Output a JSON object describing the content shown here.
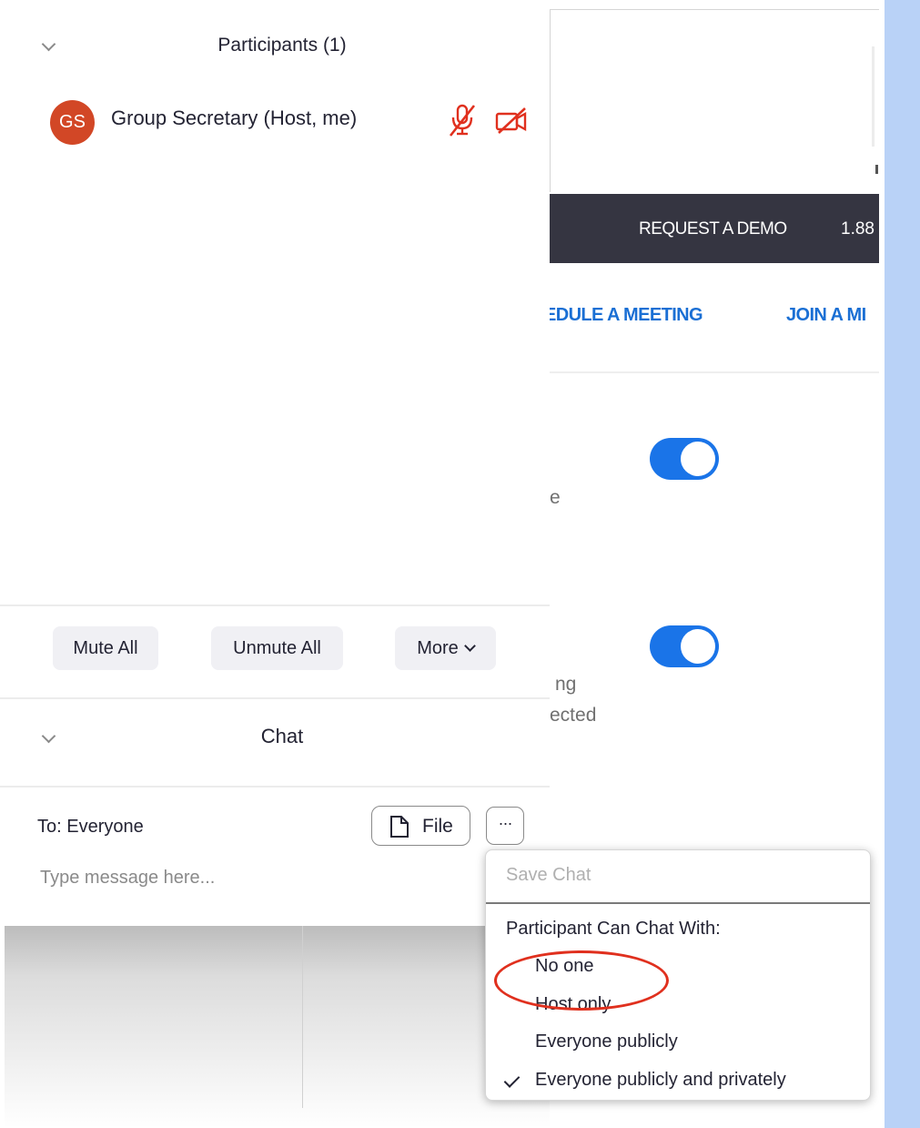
{
  "participants": {
    "title": "Participants (1)",
    "list": [
      {
        "initials": "GS",
        "name": "Group Secretary (Host, me)",
        "avatar_color": "#d24726"
      }
    ]
  },
  "actions": {
    "mute_all": "Mute All",
    "unmute_all": "Unmute All",
    "more": "More"
  },
  "chat": {
    "title": "Chat",
    "to_label": "To: Everyone",
    "file_label": "File",
    "more_label": "···",
    "placeholder": "Type message here..."
  },
  "chat_menu": {
    "save_chat": "Save Chat",
    "header": "Participant Can Chat With:",
    "options": [
      "No one",
      "Host only",
      "Everyone publicly",
      "Everyone publicly and privately"
    ],
    "selected": "Everyone publicly and privately"
  },
  "webpage": {
    "request_demo": "REQUEST A DEMO",
    "phone": "1.88",
    "schedule": "EDULE A MEETING",
    "join": "JOIN A MI",
    "frag_1": "e",
    "frag_2": "ng",
    "frag_3": "ected"
  },
  "colors": {
    "accent": "#1a74e8",
    "nav_link": "#1a6fd4",
    "muted_red": "#e0301e",
    "dark_bar": "#353541"
  }
}
